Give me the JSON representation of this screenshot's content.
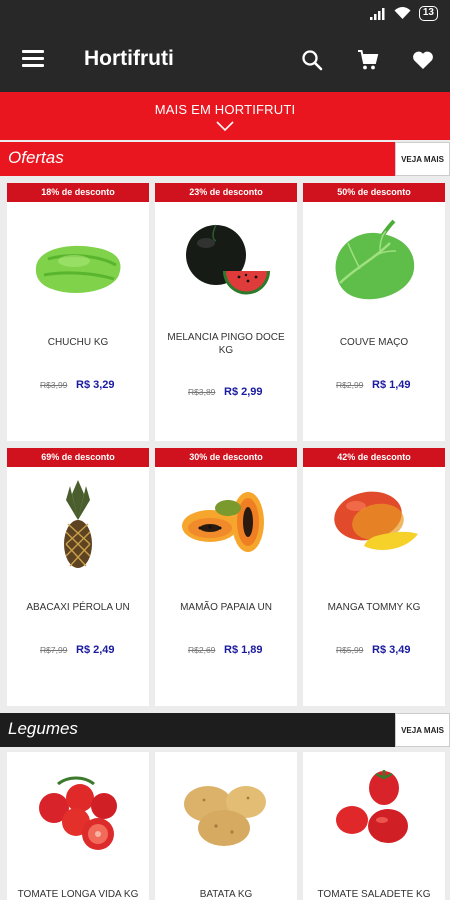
{
  "status": {
    "battery": "13"
  },
  "header": {
    "title": "Hortifruti"
  },
  "banner": {
    "label": "MAIS EM HORTIFRUTI"
  },
  "offers": {
    "title": "Ofertas",
    "see_more": "VEJA MAIS",
    "products": [
      {
        "badge": "18% de desconto",
        "name": "CHUCHU KG",
        "old_price": "R$3,99",
        "price": "R$ 3,29",
        "icon": "chayote-image"
      },
      {
        "badge": "23% de desconto",
        "name": "MELANCIA PINGO DOCE KG",
        "old_price": "R$3,89",
        "price": "R$ 2,99",
        "icon": "watermelon-image"
      },
      {
        "badge": "50% de desconto",
        "name": "COUVE MAÇO",
        "old_price": "R$2,99",
        "price": "R$ 1,49",
        "icon": "kale-image"
      },
      {
        "badge": "69% de desconto",
        "name": "ABACAXI PÉROLA UN",
        "old_price": "R$7,99",
        "price": "R$ 2,49",
        "icon": "pineapple-image"
      },
      {
        "badge": "30% de desconto",
        "name": "MAMÃO PAPAIA UN",
        "old_price": "R$2,69",
        "price": "R$ 1,89",
        "icon": "papaya-image"
      },
      {
        "badge": "42% de desconto",
        "name": "MANGA TOMMY KG",
        "old_price": "R$5,99",
        "price": "R$ 3,49",
        "icon": "mango-image"
      }
    ]
  },
  "vegetables": {
    "title": "Legumes",
    "see_more": "VEJA MAIS",
    "products": [
      {
        "name": "TOMATE LONGA VIDA KG",
        "icon": "tomato-cluster-image"
      },
      {
        "name": "BATATA KG",
        "icon": "potato-image"
      },
      {
        "name": "TOMATE SALADETE KG",
        "icon": "tomato-image"
      }
    ]
  }
}
